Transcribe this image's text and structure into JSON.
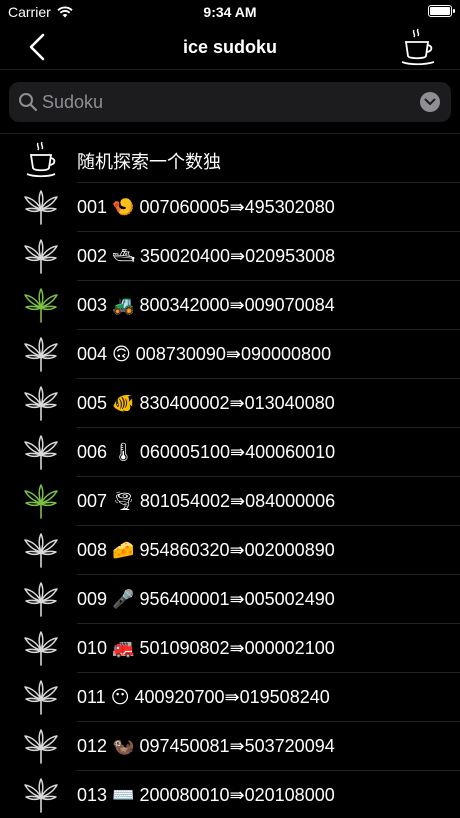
{
  "status_bar": {
    "carrier": "Carrier",
    "time": "9:34 AM",
    "icons": [
      "wifi-icon",
      "battery-icon"
    ]
  },
  "nav": {
    "title": "ice sudoku",
    "back_icon": "chevron-left-icon",
    "right_icon": "coffee-cup-icon"
  },
  "search": {
    "placeholder": "Sudoku",
    "value": ""
  },
  "list": [
    {
      "icon": "coffee-cup-icon",
      "text": "随机探索一个数独"
    },
    {
      "icon": "leaf-icon",
      "color": "#d8d8d8",
      "text": "001 🍤 007060005⇛495302080"
    },
    {
      "icon": "leaf-icon",
      "color": "#d8d8d8",
      "text": "002 🛥 350020400⇛020953008"
    },
    {
      "icon": "leaf-icon",
      "color": "#7bbf45",
      "text": "003 🚜 800342000⇛009070084"
    },
    {
      "icon": "leaf-icon",
      "color": "#d8d8d8",
      "text": "004 🙃 008730090⇛090000800"
    },
    {
      "icon": "leaf-icon",
      "color": "#d8d8d8",
      "text": "005 🐠 830400002⇛013040080"
    },
    {
      "icon": "leaf-icon",
      "color": "#d8d8d8",
      "text": "006 🌡 060005100⇛400060010"
    },
    {
      "icon": "leaf-icon",
      "color": "#7bbf45",
      "text": "007 🌪 801054002⇛084000006"
    },
    {
      "icon": "leaf-icon",
      "color": "#d8d8d8",
      "text": "008 🧀 954860320⇛002000890"
    },
    {
      "icon": "leaf-icon",
      "color": "#d8d8d8",
      "text": "009 🎤 956400001⇛005002490"
    },
    {
      "icon": "leaf-icon",
      "color": "#d8d8d8",
      "text": "010 🚒 501090802⇛000002100"
    },
    {
      "icon": "leaf-icon",
      "color": "#d8d8d8",
      "text": "011 😶 400920700⇛019508240"
    },
    {
      "icon": "leaf-icon",
      "color": "#d8d8d8",
      "text": "012 🦦 097450081⇛503720094"
    },
    {
      "icon": "leaf-icon",
      "color": "#d8d8d8",
      "text": "013 ⌨️ 200080010⇛020108000"
    }
  ]
}
